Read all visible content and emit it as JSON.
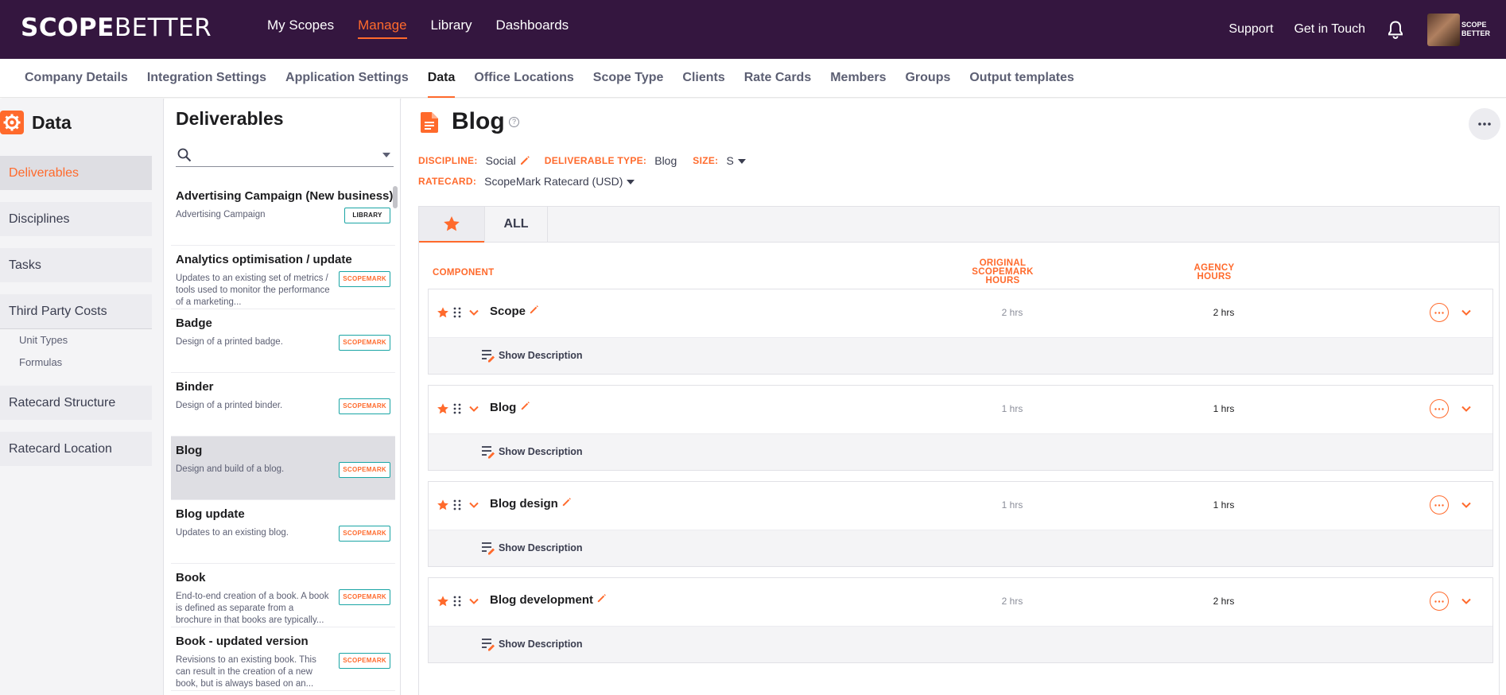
{
  "header": {
    "logo_scope": "SCOPE",
    "logo_better": "BETTER",
    "nav": [
      {
        "label": "My Scopes"
      },
      {
        "label": "Manage"
      },
      {
        "label": "Library"
      },
      {
        "label": "Dashboards"
      }
    ],
    "support": "Support",
    "get_in_touch": "Get in Touch",
    "mini_logo_line1": "SCOPE",
    "mini_logo_line2": "BETTER",
    "accent": "#ff6a2c",
    "bg": "#34163f"
  },
  "subnav": [
    {
      "label": "Company Details"
    },
    {
      "label": "Integration Settings"
    },
    {
      "label": "Application Settings"
    },
    {
      "label": "Data"
    },
    {
      "label": "Office Locations"
    },
    {
      "label": "Scope Type"
    },
    {
      "label": "Clients"
    },
    {
      "label": "Rate Cards"
    },
    {
      "label": "Members"
    },
    {
      "label": "Groups"
    },
    {
      "label": "Output templates"
    }
  ],
  "sidebar": {
    "title": "Data",
    "items": [
      {
        "label": "Deliverables"
      },
      {
        "label": "Disciplines"
      },
      {
        "label": "Tasks"
      },
      {
        "label": "Third Party Costs"
      },
      {
        "label": "Ratecard Structure"
      },
      {
        "label": "Ratecard Location"
      }
    ],
    "sub_items": [
      {
        "label": "Unit Types"
      },
      {
        "label": "Formulas"
      }
    ]
  },
  "deliverables": {
    "title": "Deliverables",
    "search_placeholder": "",
    "items": [
      {
        "name": "Advertising Campaign (New business)",
        "desc": "Advertising Campaign",
        "badge": "LIBRARY"
      },
      {
        "name": "Analytics optimisation / update",
        "desc": "Updates to an existing set of metrics / tools used to monitor the performance of a marketing...",
        "badge": "SCOPEMARK"
      },
      {
        "name": "Badge",
        "desc": "Design of a printed badge.",
        "badge": "SCOPEMARK"
      },
      {
        "name": "Binder",
        "desc": "Design of a printed binder.",
        "badge": "SCOPEMARK"
      },
      {
        "name": "Blog",
        "desc": "Design and build of a blog.",
        "badge": "SCOPEMARK"
      },
      {
        "name": "Blog update",
        "desc": "Updates to an existing blog.",
        "badge": "SCOPEMARK"
      },
      {
        "name": "Book",
        "desc": "End-to-end creation of a book. A book is defined as separate from a brochure in that books are typically...",
        "badge": "SCOPEMARK"
      },
      {
        "name": "Book - updated version",
        "desc": "Revisions to an existing book. This can result in the creation of a new book, but is always based on an...",
        "badge": "SCOPEMARK"
      }
    ]
  },
  "detail": {
    "title": "Blog",
    "help": "?",
    "discipline_label": "DISCIPLINE:",
    "discipline": "Social",
    "type_label": "DELIVERABLE TYPE:",
    "type": "Blog",
    "size_label": "SIZE:",
    "size": "S",
    "ratecard_label": "RATECARD:",
    "ratecard": "ScopeMark Ratecard (USD)",
    "tab_all": "ALL",
    "col_component": "COMPONENT",
    "col_original_1": "ORIGINAL",
    "col_original_2": "SCOPEMARK",
    "col_original_3": "HOURS",
    "col_agency_1": "AGENCY",
    "col_agency_2": "HOURS",
    "show_description": "Show Description",
    "components": [
      {
        "name": "Scope",
        "original": "2 hrs",
        "agency": "2 hrs"
      },
      {
        "name": "Blog",
        "original": "1 hrs",
        "agency": "1 hrs"
      },
      {
        "name": "Blog design",
        "original": "1 hrs",
        "agency": "1 hrs"
      },
      {
        "name": "Blog development",
        "original": "2 hrs",
        "agency": "2 hrs"
      }
    ]
  }
}
